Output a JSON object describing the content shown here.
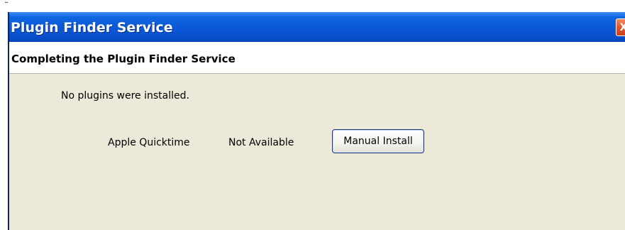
{
  "top_mark": "̈",
  "window": {
    "title": "Plugin Finder Service",
    "close_glyph": "X"
  },
  "header": {
    "title": "Completing the Plugin Finder Service"
  },
  "message": "No plugins were installed.",
  "plugins": [
    {
      "name": "Apple Quicktime",
      "status": "Not Available",
      "action_label": "Manual Install"
    }
  ],
  "colors": {
    "titlebar_blue": "#0a58d6",
    "dialog_background": "#ece9d8",
    "close_button_red": "#e0552b",
    "resize_marker_orange": "#f39a1b"
  },
  "icons": {
    "close": "close-icon"
  }
}
